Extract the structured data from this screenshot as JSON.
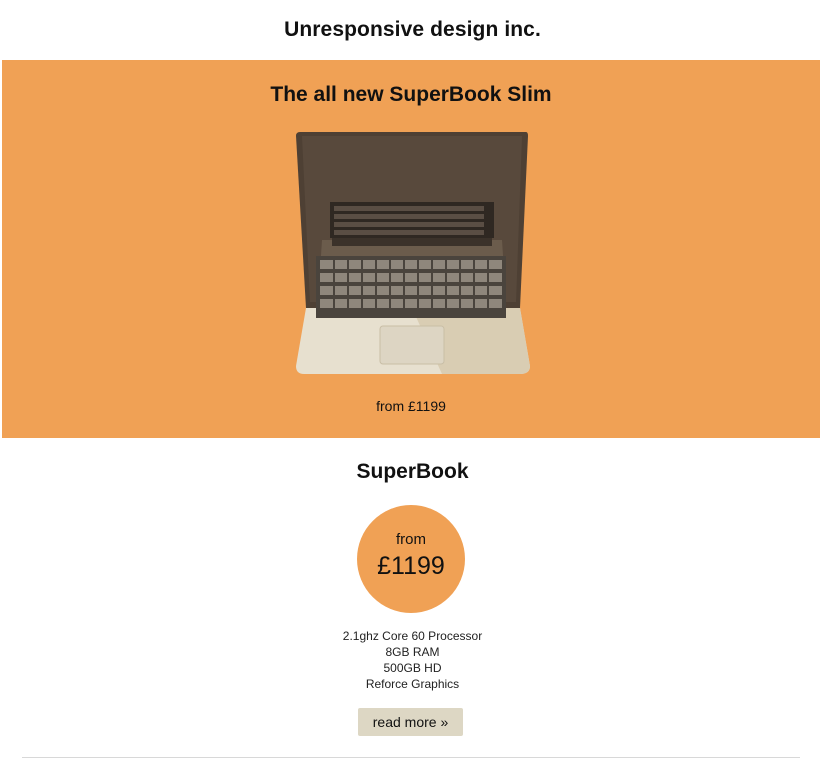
{
  "site": {
    "title": "Unresponsive design inc."
  },
  "hero": {
    "title": "The all new SuperBook Slim",
    "image_icon": "laptop-icon",
    "price_text": "from £1199",
    "background_color": "#f0a155"
  },
  "product": {
    "title": "SuperBook",
    "price_from": "from",
    "price_amount": "£1199",
    "specs": [
      "2.1ghz Core 60 Processor",
      "8GB RAM",
      "500GB HD",
      "Reforce Graphics"
    ],
    "read_more_label": "read more »"
  },
  "colors": {
    "accent": "#f0a155",
    "button": "#ddd7c4"
  }
}
